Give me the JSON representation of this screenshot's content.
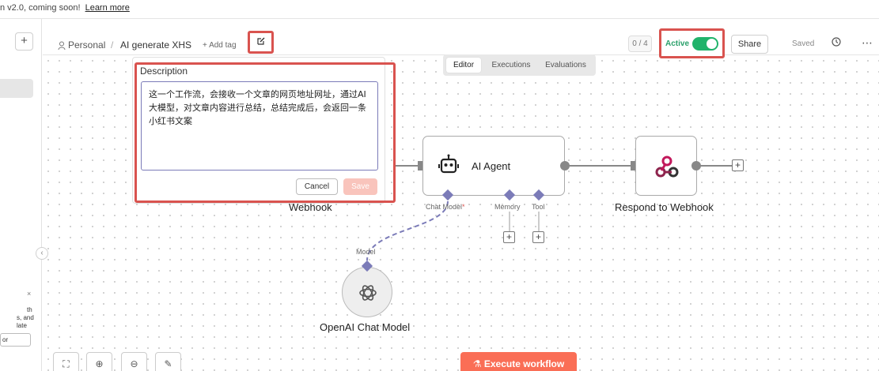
{
  "banner": {
    "text": "n v2.0, coming soon!",
    "link": "Learn more"
  },
  "sidebar": {
    "add_icon": "plus-icon",
    "promo_lines": [
      "th",
      "s, and",
      "late"
    ],
    "promo_close": "×",
    "promo_button": "or",
    "collapse_icon": "‹"
  },
  "header": {
    "project": "Personal",
    "separator": "/",
    "workflow_title": "AI generate XHS",
    "add_tag": "+ Add tag",
    "counter": "0 / 4",
    "active_label": "Active",
    "share_label": "Share",
    "saved_label": "Saved",
    "more_label": "⋯"
  },
  "tabs": [
    {
      "label": "Editor",
      "selected": true
    },
    {
      "label": "Executions",
      "selected": false
    },
    {
      "label": "Evaluations",
      "selected": false
    }
  ],
  "description": {
    "title": "Description",
    "value": "这一个工作流，会接收一个文章的网页地址网址，通过AI大模型，对文章内容进行总结，总结完成后，会返回一条小红书文案",
    "cancel_label": "Cancel",
    "save_label": "Save"
  },
  "nodes": {
    "webhook_label": "Webhook",
    "ai_agent": {
      "title": "AI Agent",
      "chat_model": "Chat Model",
      "required": "*",
      "memory": "Memory",
      "tool": "Tool"
    },
    "respond_label": "Respond to Webhook",
    "openai": {
      "label": "OpenAI Chat Model",
      "connector": "Model"
    }
  },
  "toolbar": {
    "execute_label": "Execute workflow"
  },
  "colors": {
    "accent": "#fa6e56",
    "active": "#21b36b",
    "highlight": "#d9534f",
    "connector": "#7b7bb8"
  }
}
